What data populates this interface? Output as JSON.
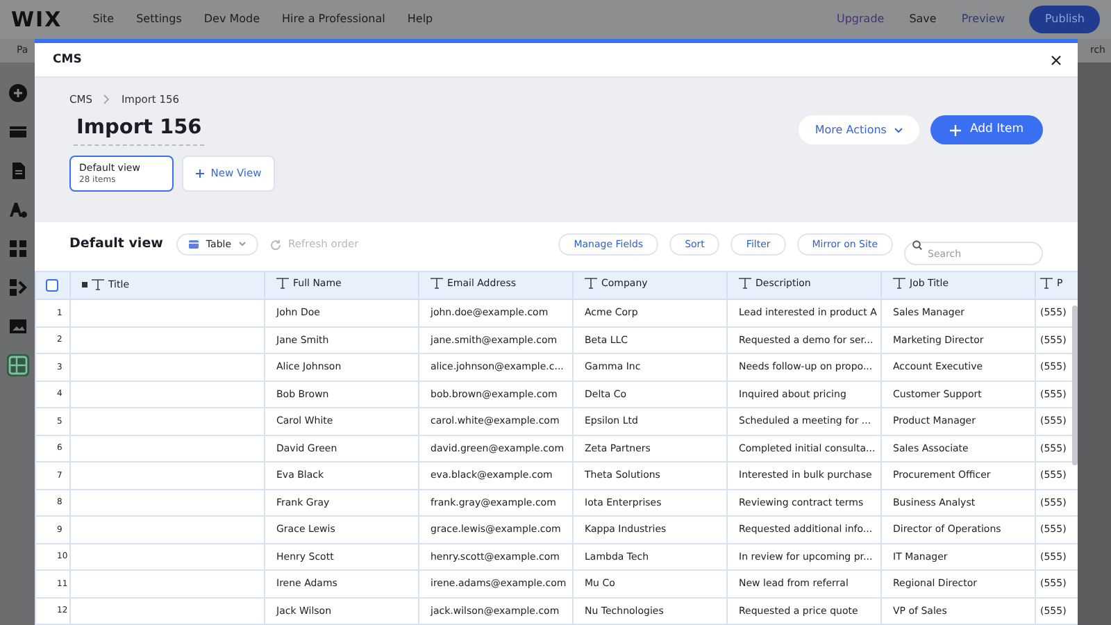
{
  "editor": {
    "logo": "WIX",
    "menu": [
      "Site",
      "Settings",
      "Dev Mode",
      "Hire a Professional",
      "Help"
    ],
    "upgrade": "Upgrade",
    "save": "Save",
    "preview": "Preview",
    "publish": "Publish",
    "subbar_left": "Pa",
    "subbar_right": "rch",
    "sidebar": [
      {
        "kind": "add",
        "selected": false
      },
      {
        "kind": "sections",
        "selected": false
      },
      {
        "kind": "page",
        "selected": false
      },
      {
        "kind": "theme",
        "selected": false
      },
      {
        "kind": "apps",
        "selected": false
      },
      {
        "kind": "business",
        "selected": false
      },
      {
        "kind": "media",
        "selected": false
      },
      {
        "kind": "cms",
        "selected": true
      }
    ]
  },
  "modal": {
    "title": "CMS",
    "breadcrumb": [
      "CMS",
      "Import 156"
    ],
    "heading": "Import 156",
    "views": [
      {
        "name": "Default view",
        "count": "28 items",
        "selected": true
      }
    ],
    "new_view": "New View",
    "more_actions": "More Actions",
    "add_item": "Add Item",
    "toolbar": {
      "view_name": "Default view",
      "layout": "Table",
      "refresh": {
        "label": "Refresh order",
        "disabled": true
      },
      "buttons": [
        "Manage Fields",
        "Sort",
        "Filter",
        "Mirror on Site"
      ],
      "search_placeholder": "Search"
    },
    "table": {
      "select_all_checked": false,
      "columns": [
        {
          "label": "Title",
          "primary": true
        },
        {
          "label": "Full Name",
          "primary": false
        },
        {
          "label": "Email Address",
          "primary": false
        },
        {
          "label": "Company",
          "primary": false
        },
        {
          "label": "Description",
          "primary": false
        },
        {
          "label": "Job Title",
          "primary": false
        },
        {
          "label": "P",
          "primary": false
        }
      ],
      "rows": [
        {
          "number": "1",
          "full_name": "John Doe",
          "email": "john.doe@example.com",
          "company": "Acme Corp",
          "description": "Lead interested in product A",
          "job_title": "Sales Manager",
          "column_7": "(555)"
        },
        {
          "number": "2",
          "full_name": "Jane Smith",
          "email": "jane.smith@example.com",
          "company": "Beta LLC",
          "description": "Requested a demo for ser...",
          "job_title": "Marketing Director",
          "column_7": "(555)"
        },
        {
          "number": "3",
          "full_name": "Alice Johnson",
          "email": "alice.johnson@example.c...",
          "company": "Gamma Inc",
          "description": "Needs follow-up on propo...",
          "job_title": "Account Executive",
          "column_7": "(555)"
        },
        {
          "number": "4",
          "full_name": "Bob Brown",
          "email": "bob.brown@example.com",
          "company": "Delta Co",
          "description": "Inquired about pricing",
          "job_title": "Customer Support",
          "column_7": "(555)"
        },
        {
          "number": "5",
          "full_name": "Carol White",
          "email": "carol.white@example.com",
          "company": "Epsilon Ltd",
          "description": "Scheduled a meeting for ...",
          "job_title": "Product Manager",
          "column_7": "(555)"
        },
        {
          "number": "6",
          "full_name": "David Green",
          "email": "david.green@example.com",
          "company": "Zeta Partners",
          "description": "Completed initial consulta...",
          "job_title": "Sales Associate",
          "column_7": "(555)"
        },
        {
          "number": "7",
          "full_name": "Eva Black",
          "email": "eva.black@example.com",
          "company": "Theta Solutions",
          "description": "Interested in bulk purchase",
          "job_title": "Procurement Officer",
          "column_7": "(555)"
        },
        {
          "number": "8",
          "full_name": "Frank Gray",
          "email": "frank.gray@example.com",
          "company": "Iota Enterprises",
          "description": "Reviewing contract terms",
          "job_title": "Business Analyst",
          "column_7": "(555)"
        },
        {
          "number": "9",
          "full_name": "Grace Lewis",
          "email": "grace.lewis@example.com",
          "company": "Kappa Industries",
          "description": "Requested additional info...",
          "job_title": "Director of Operations",
          "column_7": "(555)"
        },
        {
          "number": "10",
          "full_name": "Henry Scott",
          "email": "henry.scott@example.com",
          "company": "Lambda Tech",
          "description": "In review for upcoming pr...",
          "job_title": "IT Manager",
          "column_7": "(555)"
        },
        {
          "number": "11",
          "full_name": "Irene Adams",
          "email": "irene.adams@example.com",
          "company": "Mu Co",
          "description": "New lead from referral",
          "job_title": "Regional Director",
          "column_7": "(555)"
        },
        {
          "number": "12",
          "full_name": "Jack Wilson",
          "email": "jack.wilson@example.com",
          "company": "Nu Technologies",
          "description": "Requested a price quote",
          "job_title": "VP of Sales",
          "column_7": "(555)"
        }
      ]
    }
  }
}
